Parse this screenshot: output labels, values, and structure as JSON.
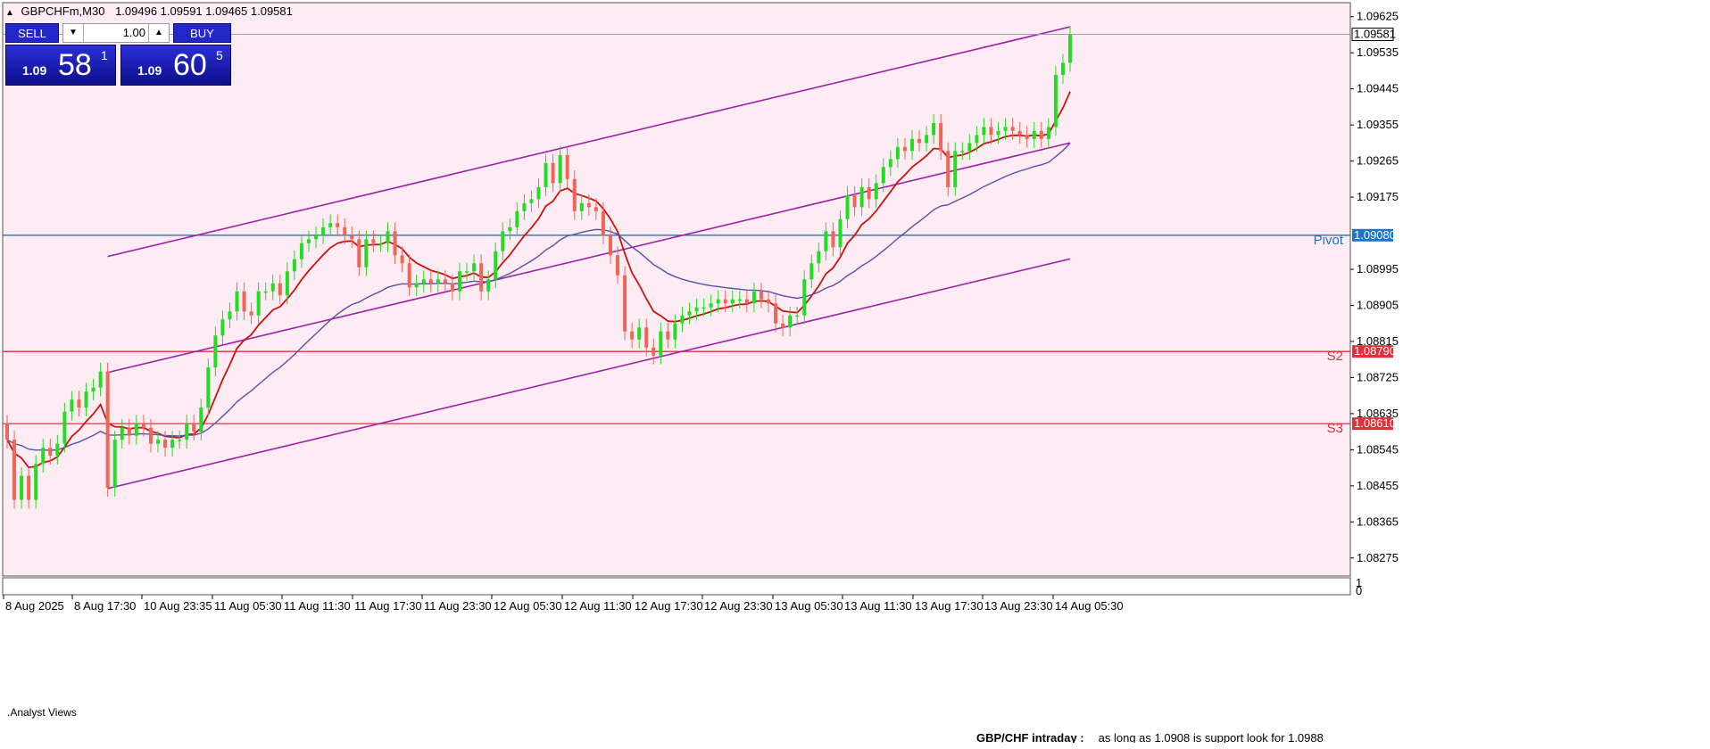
{
  "header": {
    "symbol_tf": "GBPCHFm,M30",
    "ohlc": "1.09496 1.09591 1.09465 1.09581"
  },
  "trade_panel": {
    "sell_label": "SELL",
    "buy_label": "BUY",
    "lot": "1.00",
    "sell_price": {
      "prefix": "1.09",
      "big": "58",
      "sup": "1"
    },
    "buy_price": {
      "prefix": "1.09",
      "big": "60",
      "sup": "5"
    }
  },
  "indicator_panel": {
    "label": ".Analyst Views",
    "scale_top": "1",
    "scale_bottom": "0"
  },
  "commentary": {
    "title": "GBP/CHF intraday :",
    "text": "as long as 1.0908 is support look for 1.0988"
  },
  "levels": [
    {
      "name": "Pivot",
      "value": 1.0908,
      "label": "1.09080",
      "color": "#1e74c8"
    },
    {
      "name": "S2",
      "value": 1.0879,
      "label": "1.08790",
      "color": "#e0303a"
    },
    {
      "name": "S3",
      "value": 1.0861,
      "label": "1.08610",
      "color": "#e0303a"
    }
  ],
  "current_price": {
    "value": 1.09581,
    "label": "1.09581"
  },
  "colors": {
    "background": "#fdecf3",
    "bull": "#22dd22",
    "bear": "#ee6655",
    "channel": "#a020a8",
    "ma_fast": "#cc1111",
    "ma_mid": "#5a4fa8",
    "ma_slow": "#44d0cc"
  },
  "chart_data": {
    "type": "candlestick",
    "symbol": "GBPCHFm",
    "timeframe": "M30",
    "ylim": [
      1.0823,
      1.0966
    ],
    "y_ticks": [
      "1.09625",
      "1.09535",
      "1.09445",
      "1.09355",
      "1.09265",
      "1.09175",
      "1.08995",
      "1.08905",
      "1.08815",
      "1.08725",
      "1.08635",
      "1.08545",
      "1.08455",
      "1.08365",
      "1.08275"
    ],
    "x_labels": [
      "8 Aug 2025",
      "8 Aug 17:30",
      "10 Aug 23:35",
      "11 Aug 05:30",
      "11 Aug 11:30",
      "11 Aug 17:30",
      "11 Aug 23:30",
      "12 Aug 05:30",
      "12 Aug 11:30",
      "12 Aug 17:30",
      "12 Aug 23:30",
      "13 Aug 05:30",
      "13 Aug 11:30",
      "13 Aug 17:30",
      "13 Aug 23:30",
      "14 Aug 05:30"
    ],
    "close": [
      1.0857,
      1.0842,
      1.0848,
      1.0842,
      1.0851,
      1.0855,
      1.0853,
      1.0856,
      1.0864,
      1.0867,
      1.0865,
      1.0869,
      1.087,
      1.0874,
      1.0845,
      1.0857,
      1.086,
      1.0858,
      1.0861,
      1.086,
      1.0856,
      1.0857,
      1.0855,
      1.0857,
      1.0857,
      1.0861,
      1.0859,
      1.0865,
      1.0875,
      1.0883,
      1.0887,
      1.0889,
      1.0894,
      1.0889,
      1.0888,
      1.0894,
      1.0894,
      1.0896,
      1.0893,
      1.0899,
      1.0902,
      1.0906,
      1.0907,
      1.0908,
      1.091,
      1.0911,
      1.091,
      1.0908,
      1.0907,
      1.09,
      1.0907,
      1.0906,
      1.0906,
      1.0909,
      1.0903,
      1.0901,
      1.0895,
      1.0896,
      1.0897,
      1.0896,
      1.0897,
      1.0896,
      1.0894,
      1.0899,
      1.0899,
      1.0901,
      1.0894,
      1.0897,
      1.0904,
      1.0909,
      1.091,
      1.0914,
      1.0916,
      1.0917,
      1.092,
      1.0926,
      1.0921,
      1.0928,
      1.0922,
      1.0914,
      1.0916,
      1.0915,
      1.0914,
      1.0908,
      1.0903,
      1.0898,
      1.0884,
      1.0882,
      1.0885,
      1.088,
      1.0878,
      1.0884,
      1.0882,
      1.0886,
      1.0888,
      1.0889,
      1.089,
      1.089,
      1.0891,
      1.0892,
      1.0891,
      1.0892,
      1.0892,
      1.0891,
      1.0894,
      1.0892,
      1.0891,
      1.0886,
      1.0885,
      1.0888,
      1.0888,
      1.0897,
      1.0901,
      1.0904,
      1.0909,
      1.0905,
      1.0912,
      1.0918,
      1.0915,
      1.092,
      1.0917,
      1.0921,
      1.0925,
      1.0927,
      1.093,
      1.0929,
      1.0932,
      1.0931,
      1.0933,
      1.0936,
      1.0929,
      1.092,
      1.0929,
      1.0929,
      1.0931,
      1.0933,
      1.0935,
      1.0933,
      1.0934,
      1.0935,
      1.0934,
      1.0933,
      1.0932,
      1.0934,
      1.0932,
      1.0935,
      1.0948,
      1.0951,
      1.0958
    ]
  }
}
